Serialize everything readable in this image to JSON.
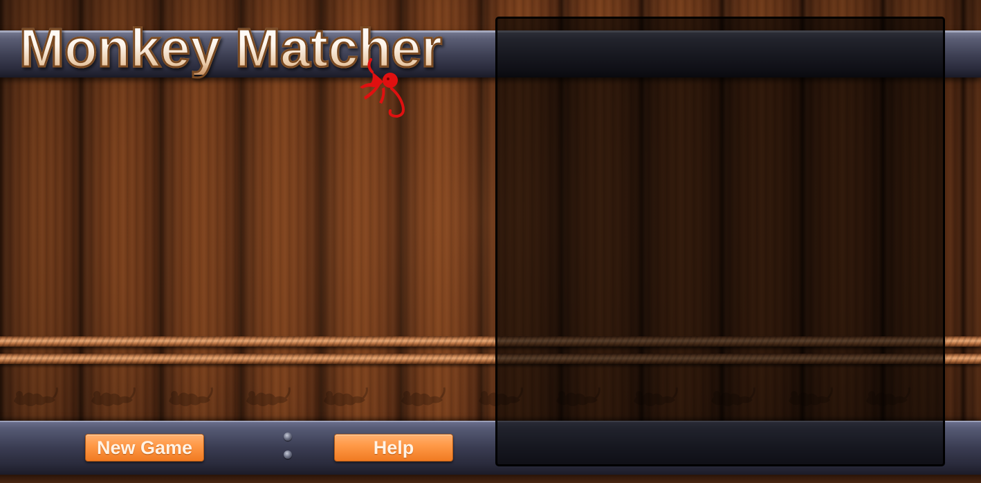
{
  "game": {
    "title": "Monkey Matcher",
    "title_mascot_icon": "red-monkey-icon",
    "decoration_icon": "monkey-silhouette-icon"
  },
  "buttons": {
    "new_game_label": "New Game",
    "help_label": "Help"
  },
  "colors": {
    "button_orange": "#ff9a48",
    "mascot_red": "#e01010",
    "metal_bar": "#3c3e52",
    "wood": "#6a3618",
    "board_overlay": "#000000"
  }
}
